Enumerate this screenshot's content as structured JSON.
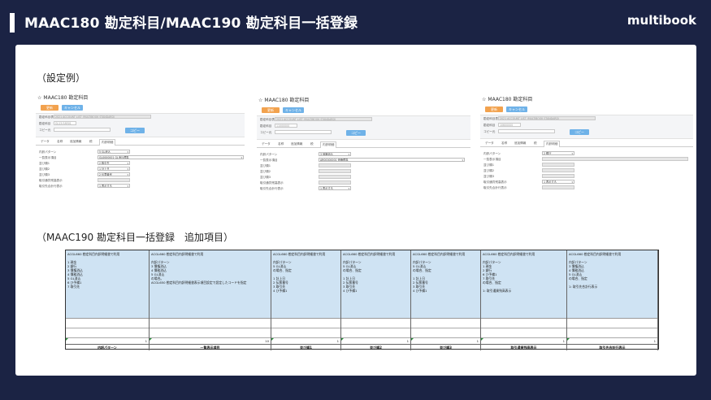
{
  "header": {
    "title": "MAAC180 勘定科目/MAAC190 勘定科目一括登録",
    "brand": "multibook"
  },
  "sections": {
    "example_label": "（設定例）",
    "additions_label": "（MAAC190 勘定科目一括登録　追加項目）"
  },
  "screens": [
    {
      "title": "MAAC180 勘定科目",
      "save": "更新",
      "cancel": "キャンセル",
      "copy": "コピー",
      "form_labels": [
        "勘定科目表",
        "勘定科目",
        "コピー元",
        "勘定科目"
      ],
      "form_values": [
        "2021 ACCOUNT LIST (MULTIBOOK STANDARD)",
        "GL13.EAR01"
      ],
      "tabs": [
        "データ",
        "名称",
        "追加情報",
        "税",
        "内訳明細"
      ],
      "active_tab": "内訳明細",
      "detail_labels": [
        "内訳パターン",
        "一覧表示項目",
        "並び順1",
        "並び順2",
        "並び順3",
        "取引通貨残高表示",
        "取引先合計行表示"
      ],
      "detail_values": [
        "5 GL消込",
        "GL0000001 GL消込標準",
        "2 取引先",
        "1 計上日",
        "2 伝票番号",
        "",
        "1 表示する"
      ]
    },
    {
      "title": "MAAC180 勘定科目",
      "save": "更新",
      "cancel": "キャンセル",
      "copy": "コピー",
      "form_labels": [
        "勘定科目表",
        "勘定科目",
        "コピー元",
        "勘定科目"
      ],
      "form_values": [
        "2021 ACCOUNT LIST (MULTIBOOK STANDARD)",
        "11000000"
      ],
      "tabs": [
        "データ",
        "名称",
        "追加情報",
        "税",
        "内訳明細"
      ],
      "active_tab": "内訳明細",
      "detail_labels": [
        "内訳パターン",
        "一覧表示項目",
        "並び順1",
        "並び順2",
        "並び順3",
        "取引通貨残高表示",
        "取引先合計行表示"
      ],
      "detail_values": [
        "3 債権消込",
        "AR00000001 債権標準",
        "",
        "",
        "",
        "",
        "1 表示する"
      ]
    },
    {
      "title": "MAAC180 勘定科目",
      "save": "更新",
      "cancel": "キャンセル",
      "copy": "コピー",
      "form_labels": [
        "勘定科目表",
        "勘定科目",
        "コピー元",
        "勘定科目"
      ],
      "form_values": [
        "2021 ACCOUNT LIST (MULTIBOOK STANDARD)",
        "10600000"
      ],
      "tabs": [
        "データ",
        "名称",
        "追加情報",
        "税",
        "内訳明細"
      ],
      "active_tab": "内訳明細",
      "detail_labels": [
        "内訳パターン",
        "一覧表示項目",
        "並び順1",
        "並び順2",
        "並び順3",
        "取引通貨残高表示",
        "取引先合計行表示"
      ],
      "detail_values": [
        "2 銀行",
        "",
        "",
        "",
        "",
        "1 表示する",
        ""
      ]
    }
  ],
  "sheet": {
    "columns": [
      {
        "note": "ACGL660 勘定科目内訳明細書で利用\n\n1 現金\n2 銀行\n3 債権消込\n4 債務消込\n5 GL消込\n6 ひ予備1\n7 取引先",
        "num": "1",
        "header": "内訳パターン"
      },
      {
        "note": "ACGL660 勘定科目内訳明細書で利用\n\n内訳パターン\n3 債権消込\n4 債務消込\n5 GL消込\nの場合。\nACGL650 勘定科目内訳明細書表示項目設定で設定したコードを指定",
        "num": "10",
        "header": "一覧表示項目"
      },
      {
        "note": "ACGL660 勘定科目内訳明細書で利用\n\n内訳パターン\n5 GL消込\nの場合、指定\n\n1 計上日\n2 伝票番号\n3 取引先\n4 ひ予備1",
        "num": "1",
        "header": "並び順1"
      },
      {
        "note": "ACGL660 勘定科目内訳明細書で利用\n\n内訳パターン\n5 GL消込\nの場合、指定\n\n1 計上日\n2 伝票番号\n3 取引先\n4 ひ予備1",
        "num": "1",
        "header": "並び順2"
      },
      {
        "note": "ACGL660 勘定科目内訳明細書で利用\n\n内訳パターン\n5 GL消込\nの場合、指定\n\n1 計上日\n2 伝票番号\n3 取引先\n4 ひ予備1",
        "num": "1",
        "header": "並び順3"
      },
      {
        "note": "ACGL660 勘定科目内訳明細書で利用\n\n内訳パターン\n1 現金\n2 銀行\n6 ひ予備1\n7 取引先\nの場合、指定\n\n1: 取引通貨残高表示",
        "num": "1",
        "header": "取引通貨残高表示"
      },
      {
        "note": "ACGL660 勘定科目内訳明細書で利用\n\n内訳パターン\n3 債権消込\n4 債務消込\n5 GL消込\nの場合、指定\n\n1: 取引先合計行表示",
        "num": "1",
        "header": "取引先合計行表示"
      }
    ]
  }
}
